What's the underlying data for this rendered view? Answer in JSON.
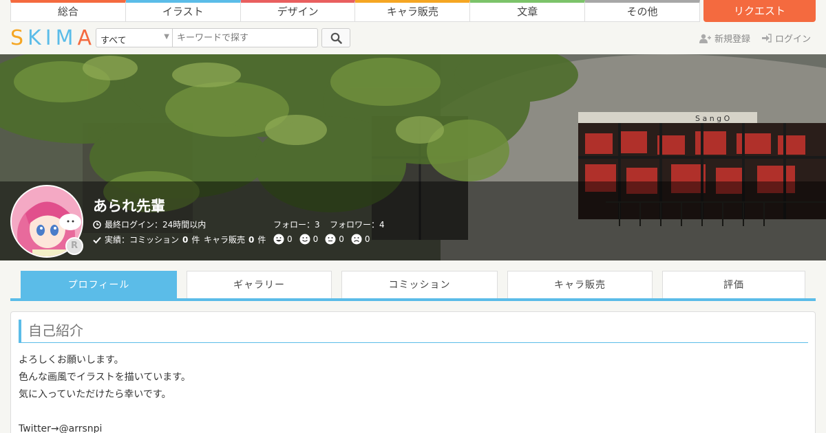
{
  "nav": {
    "categories": [
      {
        "label": "総合",
        "color": "#f46a3f"
      },
      {
        "label": "イラスト",
        "color": "#5bbce8"
      },
      {
        "label": "デザイン",
        "color": "#e95f5f"
      },
      {
        "label": "キャラ販売",
        "color": "#f5a623"
      },
      {
        "label": "文章",
        "color": "#7cc36a"
      },
      {
        "label": "その他",
        "color": "#a7a7a7"
      }
    ],
    "request_label": "リクエスト"
  },
  "header": {
    "logo_letters": [
      {
        "char": "S",
        "color": "#f5a623"
      },
      {
        "char": "K",
        "color": "#5bbce8"
      },
      {
        "char": "I",
        "color": "#5bbce8"
      },
      {
        "char": "M",
        "color": "#5bbce8"
      },
      {
        "char": "A",
        "color": "#f46a3f"
      }
    ],
    "search_category": "すべて",
    "search_placeholder": "キーワードで探す",
    "signup_label": "新規登録",
    "login_label": "ログイン"
  },
  "profile": {
    "name": "あられ先輩",
    "last_login": "最終ログイン：24時間以内",
    "follow": "フォロー：3",
    "followers": "フォロワー：4",
    "achievements_label": "実績：コミッション",
    "commission_count": "0",
    "count_unit": "件",
    "chara_label": "キャラ販売",
    "chara_count": "0",
    "ratings": [
      "0",
      "0",
      "0",
      "0"
    ],
    "rank_badge": "R"
  },
  "tabs": [
    {
      "label": "プロフィール",
      "active": true
    },
    {
      "label": "ギャラリー",
      "active": false
    },
    {
      "label": "コミッション",
      "active": false
    },
    {
      "label": "キャラ販売",
      "active": false
    },
    {
      "label": "評価",
      "active": false
    }
  ],
  "intro": {
    "title": "自己紹介",
    "lines": [
      "よろしくお願いします。",
      "色んな画風でイラストを描いています。",
      "気に入っていただけたら幸いです。",
      "",
      "Twitter→@arrsnpi"
    ]
  },
  "hero_sign_text": "S a n g O"
}
